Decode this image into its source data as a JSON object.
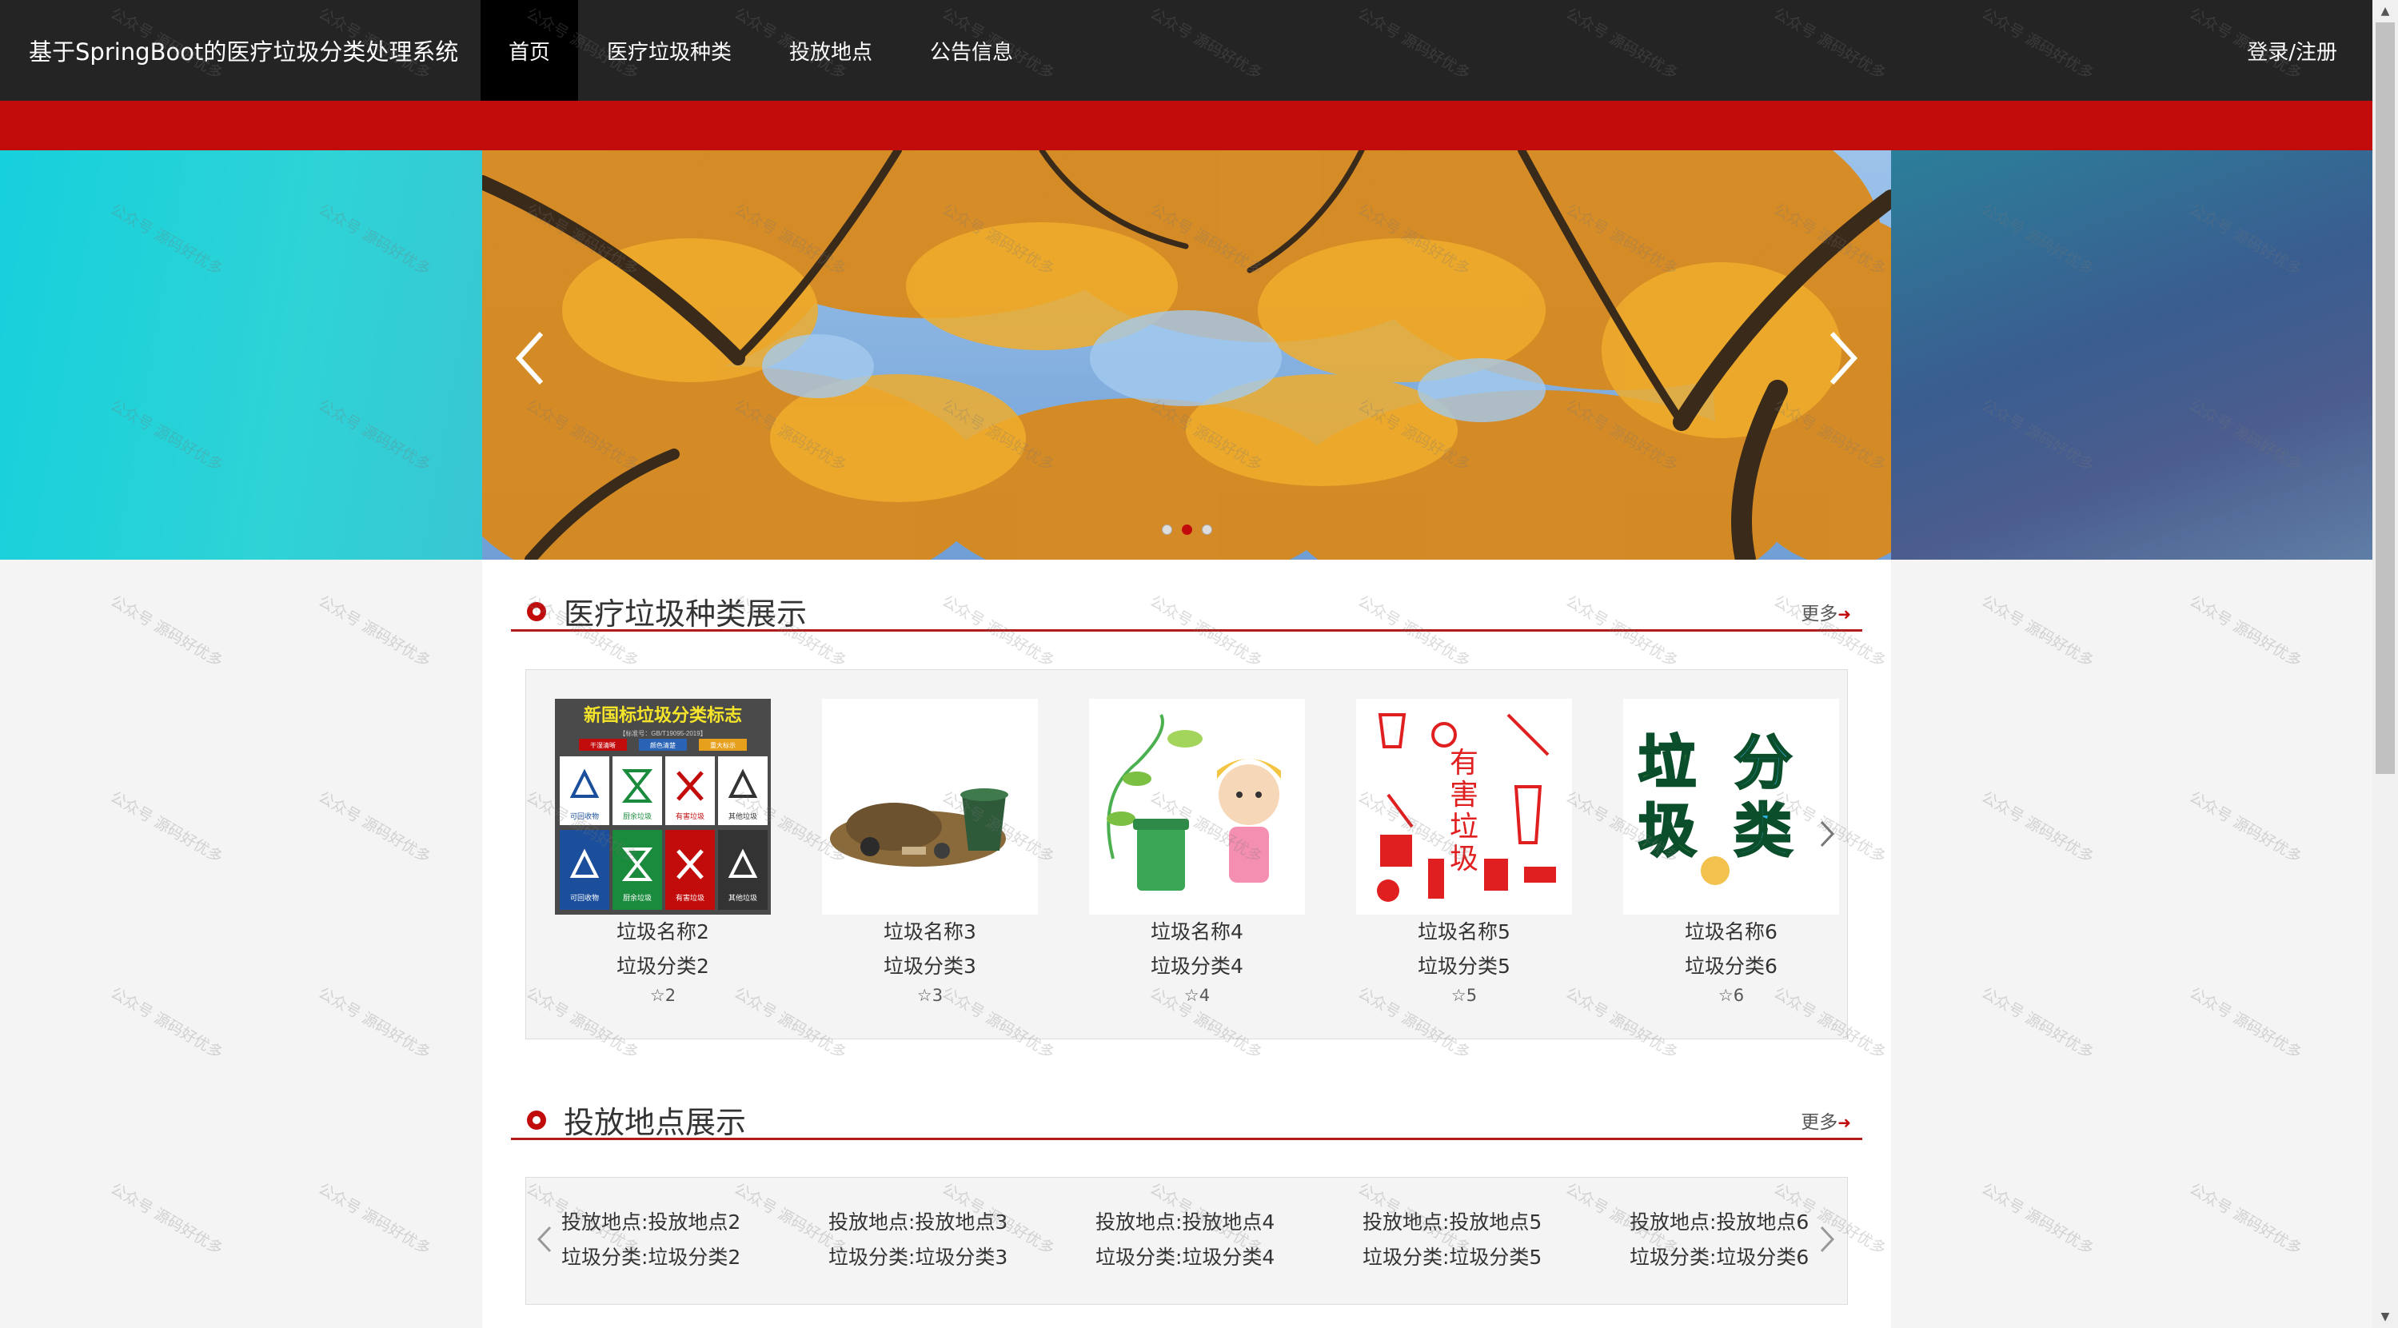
{
  "navbar": {
    "brand": "基于SpringBoot的医疗垃圾分类处理系统",
    "items": [
      {
        "label": "首页",
        "active": true
      },
      {
        "label": "医疗垃圾种类"
      },
      {
        "label": "投放地点"
      },
      {
        "label": "公告信息"
      }
    ],
    "login": "登录/注册"
  },
  "carousel": {
    "slide_count": 3,
    "active_index": 1,
    "prev_icon": "chevron-left-icon",
    "next_icon": "chevron-right-icon"
  },
  "sections": {
    "waste_types": {
      "title": "医疗垃圾种类展示",
      "more": "更多",
      "more_icon": "arrow-right-icon",
      "items": [
        {
          "name": "垃圾名称2",
          "category": "垃圾分类2",
          "rating": "2"
        },
        {
          "name": "垃圾名称3",
          "category": "垃圾分类3",
          "rating": "3"
        },
        {
          "name": "垃圾名称4",
          "category": "垃圾分类4",
          "rating": "4"
        },
        {
          "name": "垃圾名称5",
          "category": "垃圾分类5",
          "rating": "5"
        },
        {
          "name": "垃圾名称6",
          "category": "垃圾分类6",
          "rating": "6"
        }
      ],
      "sign": {
        "title": "新国标垃圾分类标志",
        "subtitle": "【标准号：GB/T19095-2019】",
        "tags": [
          "干湿清晰",
          "颜色清楚",
          "重大标示"
        ],
        "labels": [
          "可回收物",
          "厨余垃圾",
          "有害垃圾",
          "其他垃圾"
        ]
      },
      "poster5_text": [
        "有",
        "害",
        "垃",
        "圾"
      ],
      "poster6_text": [
        "垃",
        "圾",
        "分",
        "类"
      ]
    },
    "locations": {
      "title": "投放地点展示",
      "more": "更多",
      "more_icon": "arrow-right-icon",
      "items": [
        {
          "place": "投放地点:投放地点2",
          "category": "垃圾分类:垃圾分类2"
        },
        {
          "place": "投放地点:投放地点3",
          "category": "垃圾分类:垃圾分类3"
        },
        {
          "place": "投放地点:投放地点4",
          "category": "垃圾分类:垃圾分类4"
        },
        {
          "place": "投放地点:投放地点5",
          "category": "垃圾分类:垃圾分类5"
        },
        {
          "place": "投放地点:投放地点6",
          "category": "垃圾分类:垃圾分类6"
        }
      ]
    }
  },
  "watermark": "公众号 源码好优多",
  "colors": {
    "nav": "#242424",
    "accent": "#c20c0c"
  }
}
